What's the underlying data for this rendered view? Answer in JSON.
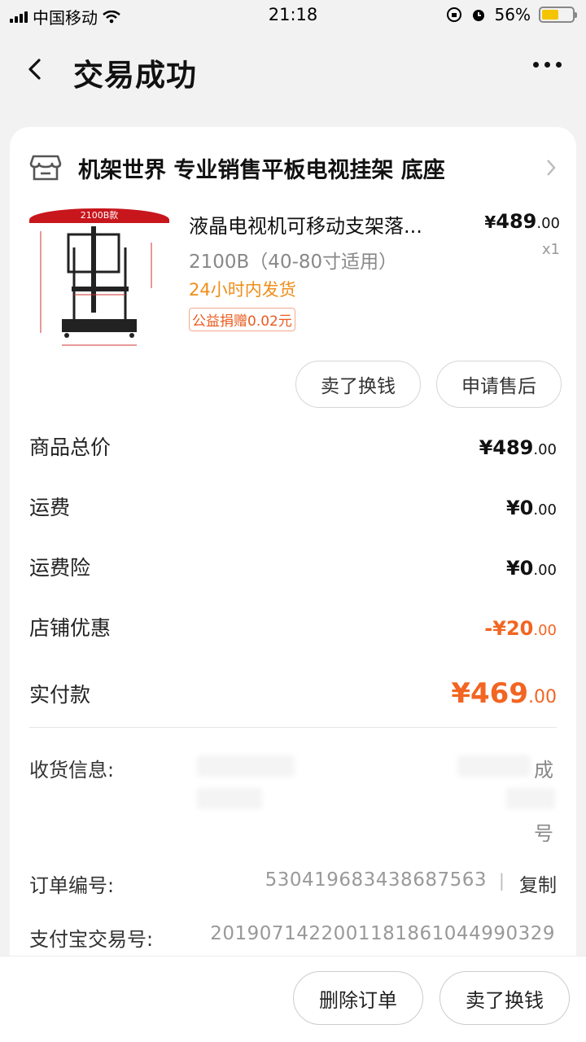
{
  "status_bar": {
    "carrier": "中国移动",
    "time": "21:18",
    "battery": "56%",
    "battery_level": 0.56
  },
  "nav": {
    "title": "交易成功"
  },
  "shop": {
    "name": "机架世界 专业销售平板电视挂架 底座"
  },
  "product": {
    "image_banner": "2100B款",
    "name": "液晶电视机可移动支架落...",
    "price_symbol": "¥",
    "price_int": "489",
    "price_dec": ".00",
    "spec": "2100B（40-80寸适用）",
    "quantity": "x1",
    "shipping": "24小时内发货",
    "donation": "公益捐赠0.02元"
  },
  "actions": {
    "resell": "卖了换钱",
    "after_sale": "申请售后"
  },
  "summary": {
    "goods_total_label": "商品总价",
    "goods_total_int": "¥489",
    "goods_total_dec": ".00",
    "shipping_label": "运费",
    "shipping_int": "¥0",
    "shipping_dec": ".00",
    "insurance_label": "运费险",
    "insurance_int": "¥0",
    "insurance_dec": ".00",
    "discount_label": "店铺优惠",
    "discount_int": "-¥20",
    "discount_dec": ".00",
    "paid_label": "实付款",
    "paid_int": "¥469",
    "paid_dec": ".00"
  },
  "address": {
    "label": "收货信息:",
    "line1_tail": "成",
    "line3_tail": "号"
  },
  "order": {
    "number_label": "订单编号:",
    "number": "530419683438687563",
    "separator": "|",
    "copy": "复制",
    "alipay_label": "支付宝交易号:",
    "alipay_number": "2019071422001181861044990329"
  },
  "bottom": {
    "delete": "删除订单",
    "resell": "卖了换钱"
  },
  "colors": {
    "accent": "#f26522",
    "shipping": "#f08d18"
  }
}
